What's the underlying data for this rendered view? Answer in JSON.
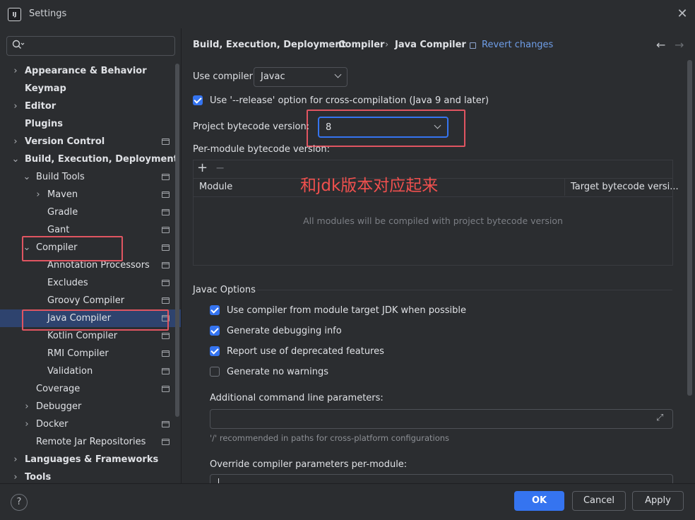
{
  "window": {
    "title": "Settings",
    "app_icon": "IJ"
  },
  "search": {
    "placeholder": ""
  },
  "sidebar": {
    "items": [
      {
        "label": "Appearance & Behavior",
        "arrow": "›"
      },
      {
        "label": "Keymap",
        "arrow": ""
      },
      {
        "label": "Editor",
        "arrow": "›"
      },
      {
        "label": "Plugins",
        "arrow": ""
      },
      {
        "label": "Version Control",
        "arrow": "›"
      },
      {
        "label": "Build, Execution, Deployment",
        "arrow": "⌄"
      },
      {
        "label": "Build Tools",
        "arrow": "⌄"
      },
      {
        "label": "Maven",
        "arrow": "›"
      },
      {
        "label": "Gradle",
        "arrow": ""
      },
      {
        "label": "Gant",
        "arrow": ""
      },
      {
        "label": "Compiler",
        "arrow": "⌄"
      },
      {
        "label": "Annotation Processors",
        "arrow": ""
      },
      {
        "label": "Excludes",
        "arrow": ""
      },
      {
        "label": "Groovy Compiler",
        "arrow": ""
      },
      {
        "label": "Java Compiler",
        "arrow": ""
      },
      {
        "label": "Kotlin Compiler",
        "arrow": ""
      },
      {
        "label": "RMI Compiler",
        "arrow": ""
      },
      {
        "label": "Validation",
        "arrow": ""
      },
      {
        "label": "Coverage",
        "arrow": ""
      },
      {
        "label": "Debugger",
        "arrow": "›"
      },
      {
        "label": "Docker",
        "arrow": "›"
      },
      {
        "label": "Remote Jar Repositories",
        "arrow": ""
      },
      {
        "label": "Languages & Frameworks",
        "arrow": "›"
      },
      {
        "label": "Tools",
        "arrow": "›"
      }
    ]
  },
  "breadcrumb": {
    "parts": [
      "Build, Execution, Deployment",
      "Compiler",
      "Java Compiler"
    ],
    "separator": "›",
    "revert_label": "Revert changes"
  },
  "nav": {
    "back": "←",
    "forward": "→"
  },
  "compiler": {
    "use_compiler_label": "Use compiler:",
    "use_compiler_value": "Javac",
    "release_option_label": "Use '--release' option for cross-compilation (Java 9 and later)",
    "release_option_checked": true,
    "bytecode_label": "Project bytecode version:",
    "bytecode_value": "8",
    "per_module_label": "Per-module bytecode version:"
  },
  "module_table": {
    "add_icon": "+",
    "remove_icon": "−",
    "columns": [
      "Module",
      "Target bytecode versi..."
    ],
    "empty_text": "All modules will be compiled with project bytecode version"
  },
  "annotation": {
    "text": "和jdk版本对应起来",
    "color": "#f0504e"
  },
  "javac_options": {
    "title": "Javac Options",
    "options": [
      {
        "label": "Use compiler from module target JDK when possible",
        "checked": true
      },
      {
        "label": "Generate debugging info",
        "checked": true
      },
      {
        "label": "Report use of deprecated features",
        "checked": true
      },
      {
        "label": "Generate no warnings",
        "checked": false
      }
    ],
    "additional_params_label": "Additional command line parameters:",
    "additional_params_value": "",
    "expand_icon": "⤢",
    "hint": "'/' recommended in paths for cross-platform configurations",
    "override_label": "Override compiler parameters per-module:"
  },
  "footer": {
    "help": "?",
    "ok": "OK",
    "cancel": "Cancel",
    "apply": "Apply"
  },
  "colors": {
    "accent": "#3574f0",
    "highlight_box": "#e05561",
    "link": "#6f9ee8",
    "selection": "#2e436e"
  }
}
